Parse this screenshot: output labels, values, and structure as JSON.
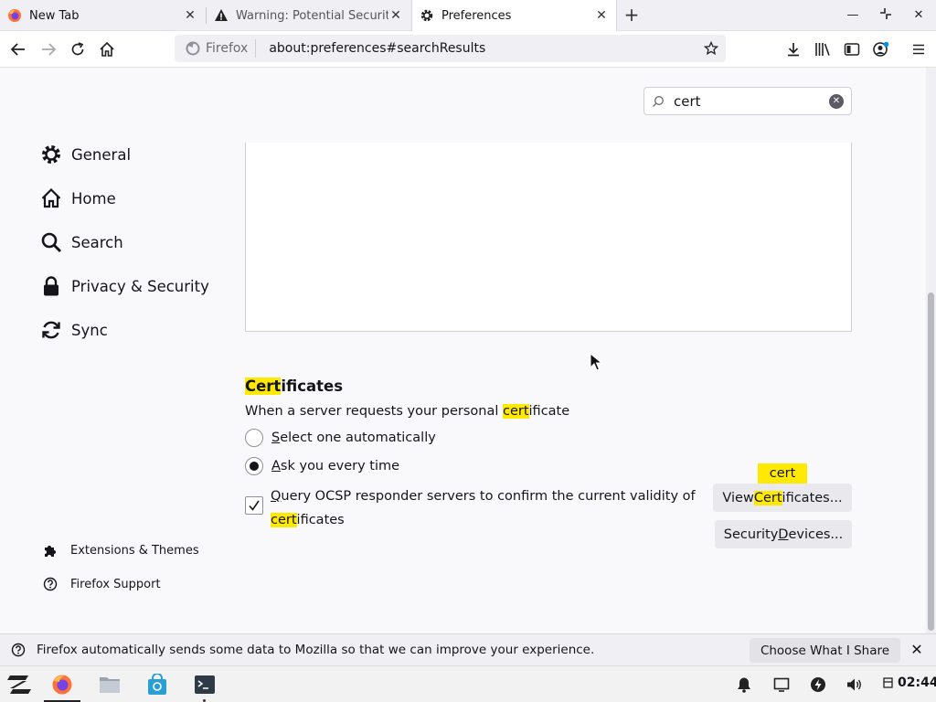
{
  "tabs": [
    {
      "title": "New Tab",
      "icon": "firefox-icon",
      "active": false
    },
    {
      "title": "Warning: Potential Securit",
      "icon": "warning-icon",
      "active": false
    },
    {
      "title": "Preferences",
      "icon": "gear-icon",
      "active": true
    }
  ],
  "navbar": {
    "identity_label": "Firefox",
    "url": "about:preferences#searchResults"
  },
  "search": {
    "value": "cert"
  },
  "sidebar": {
    "items": [
      {
        "label": "General",
        "icon": "gear-icon"
      },
      {
        "label": "Home",
        "icon": "home-icon"
      },
      {
        "label": "Search",
        "icon": "search-icon"
      },
      {
        "label": "Privacy & Security",
        "icon": "lock-icon"
      },
      {
        "label": "Sync",
        "icon": "sync-icon"
      }
    ],
    "footer": [
      {
        "label": "Extensions & Themes",
        "icon": "puzzle-icon"
      },
      {
        "label": "Firefox Support",
        "icon": "help-icon"
      }
    ]
  },
  "certificates": {
    "heading_highlight": "Cert",
    "heading_rest": "ificates",
    "description_before": "When a server requests your personal ",
    "description_highlight": "cert",
    "description_after": "ificate",
    "radio_options": [
      {
        "access_key": "S",
        "rest": "elect one automatically",
        "selected": false
      },
      {
        "access_key": "A",
        "rest": "sk you every time",
        "selected": true
      }
    ],
    "ocsp": {
      "checked": true,
      "access_key": "Q",
      "text_before": "uery OCSP responder servers to confirm the current validity of ",
      "highlight": "cert",
      "text_after": "ificates"
    },
    "search_badge": "cert",
    "view_button": {
      "before": "View ",
      "highlight": "Cert",
      "after": "ificates..."
    },
    "devices_button": {
      "before": "Security ",
      "access_key": "D",
      "after": "evices..."
    }
  },
  "notification": {
    "text": "Firefox automatically sends some data to Mozilla so that we can improve your experience.",
    "button_label": "Choose What I Share"
  },
  "taskbar": {
    "clock": "02:44"
  }
}
